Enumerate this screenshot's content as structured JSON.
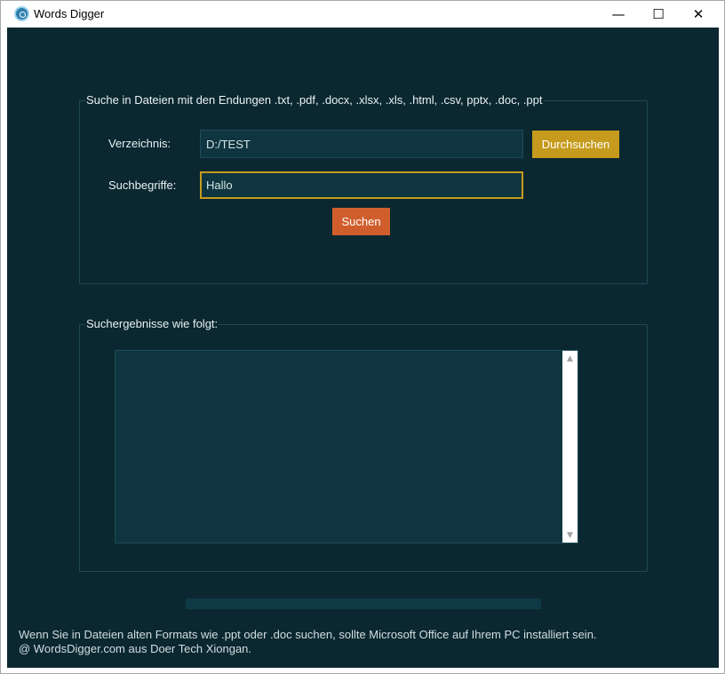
{
  "window": {
    "title": "Words Digger",
    "controls": {
      "minimize": "—",
      "maximize": "☐",
      "close": "✕"
    }
  },
  "search_group": {
    "legend": "Suche in Dateien mit den Endungen .txt, .pdf, .docx, .xlsx, .xls, .html, .csv, pptx, .doc, .ppt",
    "directory_label": "Verzeichnis:",
    "directory_value": "D:/TEST",
    "browse_button": "Durchsuchen",
    "terms_label": "Suchbegriffe:",
    "terms_value": "Hallo",
    "search_button": "Suchen"
  },
  "results_group": {
    "legend": "Suchergebnisse wie folgt:",
    "content": "",
    "scroll_up": "▲",
    "scroll_down": "▼"
  },
  "progress": {
    "percent": 0
  },
  "footer": {
    "note": "Wenn Sie in Dateien alten Formats wie .ppt oder .doc suchen, sollte Microsoft Office auf Ihrem PC installiert sein.",
    "copyright": "@ WordsDigger.com aus Doer Tech Xiongan."
  },
  "colors": {
    "background": "#0b2831",
    "browse_button": "#c69b1d",
    "search_button": "#d05e2d",
    "focus_border": "#c69b1d"
  }
}
